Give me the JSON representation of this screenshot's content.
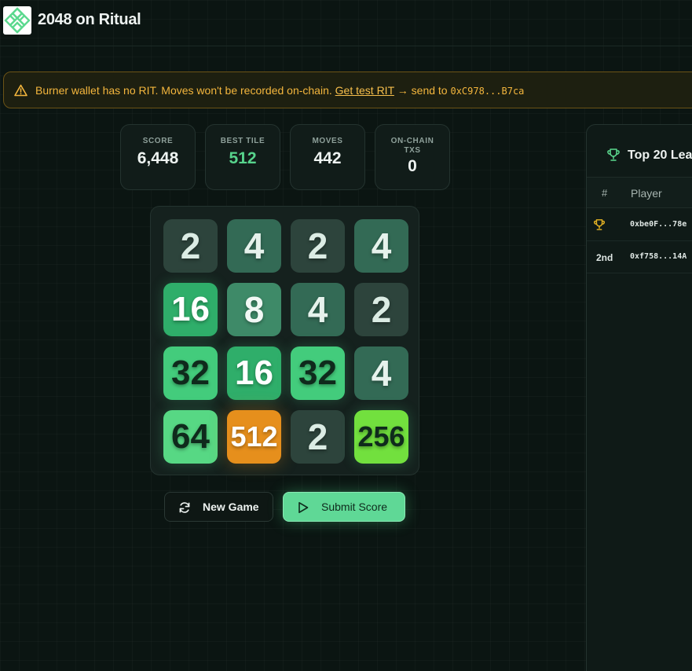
{
  "app": {
    "title": "2048 on Ritual",
    "logo_icon": "ritual-knot-logo"
  },
  "banner": {
    "message": "Burner wallet has no RIT. Moves won't be recorded on-chain.",
    "link_label": "Get test RIT",
    "arrow_text": "→ send to",
    "address": "0xC978...B7ca",
    "color": "#f4b63d"
  },
  "stats": {
    "score": {
      "label": "SCORE",
      "value": "6,448"
    },
    "best_tile": {
      "label": "BEST TILE",
      "value": "512"
    },
    "moves": {
      "label": "MOVES",
      "value": "442"
    },
    "txs": {
      "label_line1": "ON-CHAIN",
      "label_line2": "TXS",
      "value": "0"
    }
  },
  "board": {
    "grid": [
      [
        "2",
        "4",
        "2",
        "4"
      ],
      [
        "16",
        "8",
        "4",
        "2"
      ],
      [
        "32",
        "16",
        "32",
        "4"
      ],
      [
        "64",
        "512",
        "2",
        "256"
      ]
    ],
    "tile_colors": {
      "2": "#2d443c",
      "4": "#336a55",
      "8": "#3e8a68",
      "16": "#2fae6a",
      "32": "#43cc7c",
      "64": "#57d884",
      "256": "#72e03e",
      "512": "#e68f1c"
    },
    "tile_text_colors": {
      "2": "#dbece4",
      "4": "#e6f2ec",
      "8": "#f2f8f5",
      "16": "#ffffff",
      "32": "#0f2a1c",
      "64": "#0f2a1c",
      "256": "#0f2a1c",
      "512": "#ffffff"
    }
  },
  "controls": {
    "new_game_label": "New Game",
    "new_game_icon": "refresh-icon",
    "submit_label": "Submit Score",
    "submit_icon": "play-icon",
    "accent": "#5fd896"
  },
  "leaderboard": {
    "title": "Top 20 Lea",
    "title_icon": "trophy-icon",
    "col_rank": "#",
    "col_player": "Player",
    "rows": [
      {
        "rank": "",
        "rank_icon": "gold-trophy-icon",
        "player": "0xbe0F...78e"
      },
      {
        "rank": "2nd",
        "player": "0xf758...14A"
      }
    ]
  }
}
